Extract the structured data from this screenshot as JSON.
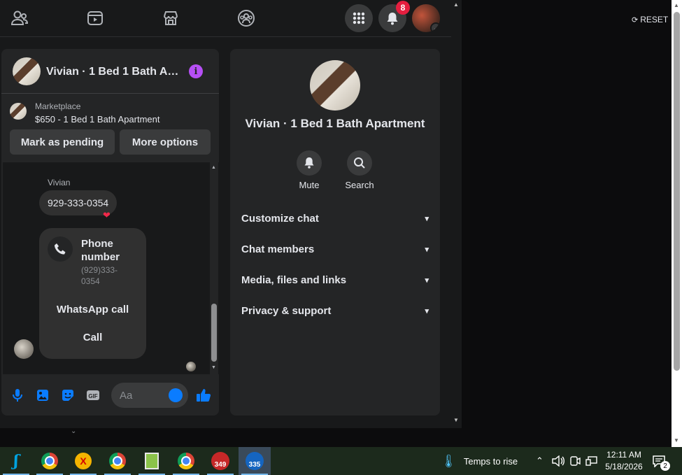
{
  "topbar": {
    "nav_icons": [
      "friends-icon",
      "watch-icon",
      "marketplace-icon",
      "groups-icon"
    ],
    "notification_count": "8"
  },
  "chat": {
    "title": "Vivian · 1 Bed 1 Bath Apartment",
    "marketplace_label": "Marketplace",
    "listing": "$650 - 1 Bed 1 Bath Apartment",
    "mark_pending": "Mark as pending",
    "more_options": "More options",
    "sender": "Vivian",
    "message": "929-333-0354",
    "phone_card": {
      "title": "Phone number",
      "number": "(929)333-0354",
      "whatsapp": "WhatsApp call",
      "call": "Call"
    },
    "composer_placeholder": "Aa"
  },
  "info": {
    "name": "Vivian · 1 Bed 1 Bath Apartment",
    "mute": "Mute",
    "search": "Search",
    "sections": [
      "Customize chat",
      "Chat members",
      "Media, files and links",
      "Privacy & support"
    ]
  },
  "reset_label": "RESET",
  "taskbar": {
    "app_badges": [
      "349",
      "335"
    ],
    "weather": "Temps to rise",
    "time": "12:11 AM",
    "date": "5/18/2026",
    "notif_count": "2"
  },
  "colors": {
    "accent": "#0a7cff",
    "info": "#b64ff5",
    "badge": "#e41e3f"
  }
}
